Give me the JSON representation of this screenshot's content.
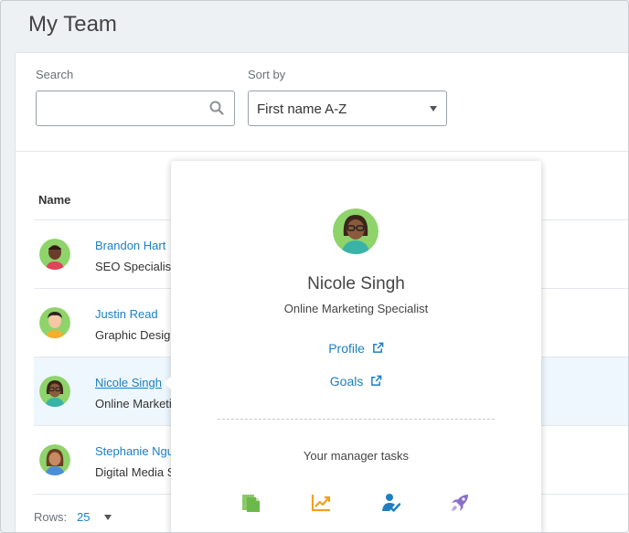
{
  "page": {
    "title": "My Team"
  },
  "filters": {
    "search_label": "Search",
    "search_value": "",
    "search_placeholder": "",
    "sort_label": "Sort by",
    "sort_value": "First name A-Z"
  },
  "table": {
    "column_name": "Name",
    "rows": [
      {
        "name": "Brandon Hart",
        "title": "SEO Specialist"
      },
      {
        "name": "Justin Read",
        "title": "Graphic Design"
      },
      {
        "name": "Nicole Singh",
        "title": "Online Marketing"
      },
      {
        "name": "Stephanie Ngu",
        "title": "Digital Media S"
      }
    ],
    "rows_label": "Rows:",
    "rows_value": "25"
  },
  "popover": {
    "name": "Nicole Singh",
    "title": "Online Marketing Specialist",
    "profile_link": "Profile",
    "goals_link": "Goals",
    "tasks_label": "Your manager tasks",
    "task_icons": [
      "documents-icon",
      "chart-line-icon",
      "user-check-icon",
      "rocket-icon"
    ]
  },
  "colors": {
    "link": "#1d7fc1",
    "avatar_bg": "#8fd36b",
    "task_green": "#6cb94b",
    "task_orange": "#f0a21d",
    "task_blue": "#1d7fc1",
    "task_purple": "#8a6fc7"
  }
}
